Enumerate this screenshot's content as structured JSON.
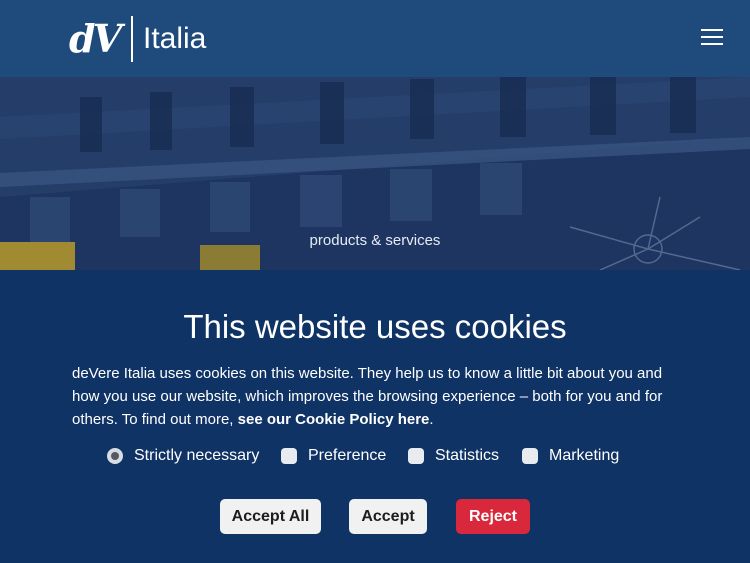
{
  "header": {
    "logo_mark": "dV",
    "logo_word": "Italia",
    "menu_icon": "hamburger-menu-icon"
  },
  "hero": {
    "caption": "products & services"
  },
  "cookie_banner": {
    "title": "This website uses cookies",
    "text_part1": "deVere Italia uses cookies on this website. They help us to know a little bit about you and how you use our website, which improves the browsing experience – both for you and for others. To find out more,",
    "policy_link": "see our Cookie Policy here",
    "text_end": ".",
    "options": [
      {
        "label": "Strictly necessary",
        "checked": true,
        "locked": true
      },
      {
        "label": "Preference",
        "checked": false
      },
      {
        "label": "Statistics",
        "checked": false
      },
      {
        "label": "Marketing",
        "checked": false
      }
    ],
    "buttons": {
      "accept_all": "Accept All",
      "accept": "Accept",
      "reject": "Reject"
    }
  },
  "colors": {
    "header_bg": "#1f4a7c",
    "banner_bg": "#0f3365",
    "reject": "#d9283c"
  }
}
